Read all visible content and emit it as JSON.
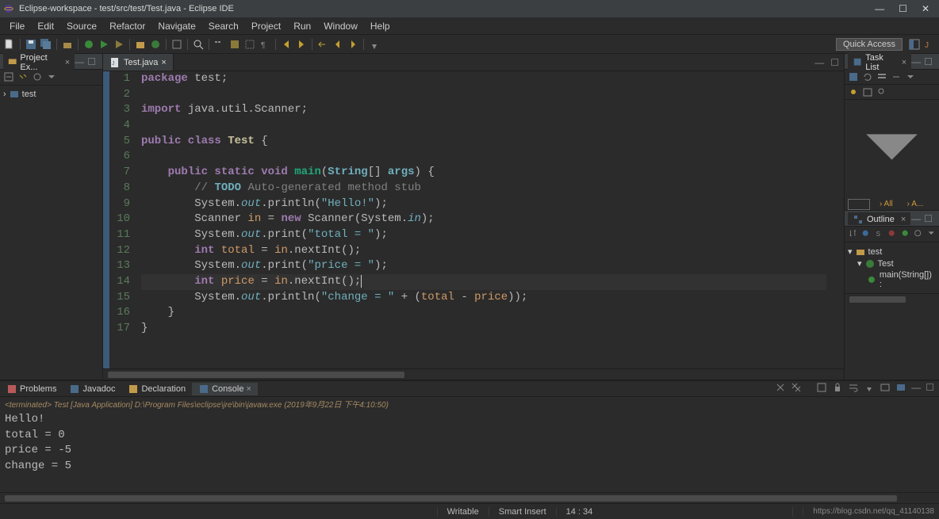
{
  "titlebar": {
    "title": "Eclipse-workspace - test/src/test/Test.java - Eclipse IDE"
  },
  "menu": [
    "File",
    "Edit",
    "Source",
    "Refactor",
    "Navigate",
    "Search",
    "Project",
    "Run",
    "Window",
    "Help"
  ],
  "quick_access": "Quick Access",
  "project_explorer": {
    "title": "Project Ex...",
    "items": [
      {
        "name": "test"
      }
    ]
  },
  "editor": {
    "tab": "Test.java",
    "lines": [
      {
        "n": 1,
        "segs": [
          {
            "t": "package ",
            "c": "kw"
          },
          {
            "t": "test;",
            "c": ""
          }
        ]
      },
      {
        "n": 2,
        "segs": []
      },
      {
        "n": 3,
        "segs": [
          {
            "t": "import ",
            "c": "kw"
          },
          {
            "t": "java.util.Scanner;",
            "c": ""
          }
        ]
      },
      {
        "n": 4,
        "segs": []
      },
      {
        "n": 5,
        "segs": [
          {
            "t": "public class ",
            "c": "kw"
          },
          {
            "t": "Test",
            "c": "cls"
          },
          {
            "t": " {",
            "c": ""
          }
        ]
      },
      {
        "n": 6,
        "segs": []
      },
      {
        "n": 7,
        "segs": [
          {
            "t": "    ",
            "c": ""
          },
          {
            "t": "public static void ",
            "c": "kw"
          },
          {
            "t": "main",
            "c": "method"
          },
          {
            "t": "(",
            "c": ""
          },
          {
            "t": "String",
            "c": "type"
          },
          {
            "t": "[] ",
            "c": ""
          },
          {
            "t": "args",
            "c": "type"
          },
          {
            "t": ") {",
            "c": ""
          }
        ]
      },
      {
        "n": 8,
        "segs": [
          {
            "t": "        ",
            "c": ""
          },
          {
            "t": "// ",
            "c": "comment"
          },
          {
            "t": "TODO",
            "c": "comment-kw"
          },
          {
            "t": " Auto-generated method stub",
            "c": "comment"
          }
        ]
      },
      {
        "n": 9,
        "segs": [
          {
            "t": "        System.",
            "c": ""
          },
          {
            "t": "out",
            "c": "field"
          },
          {
            "t": ".println(",
            "c": ""
          },
          {
            "t": "\"Hello!\"",
            "c": "str"
          },
          {
            "t": ");",
            "c": ""
          }
        ]
      },
      {
        "n": 10,
        "segs": [
          {
            "t": "        Scanner ",
            "c": ""
          },
          {
            "t": "in",
            "c": "name"
          },
          {
            "t": " = ",
            "c": ""
          },
          {
            "t": "new",
            "c": "kw"
          },
          {
            "t": " Scanner(System.",
            "c": ""
          },
          {
            "t": "in",
            "c": "field"
          },
          {
            "t": ");",
            "c": ""
          }
        ]
      },
      {
        "n": 11,
        "segs": [
          {
            "t": "        System.",
            "c": ""
          },
          {
            "t": "out",
            "c": "field"
          },
          {
            "t": ".print(",
            "c": ""
          },
          {
            "t": "\"total = \"",
            "c": "str"
          },
          {
            "t": ");",
            "c": ""
          }
        ]
      },
      {
        "n": 12,
        "segs": [
          {
            "t": "        ",
            "c": ""
          },
          {
            "t": "int",
            "c": "kw"
          },
          {
            "t": " ",
            "c": ""
          },
          {
            "t": "total",
            "c": "name"
          },
          {
            "t": " = ",
            "c": ""
          },
          {
            "t": "in",
            "c": "name"
          },
          {
            "t": ".nextInt();",
            "c": ""
          }
        ]
      },
      {
        "n": 13,
        "segs": [
          {
            "t": "        System.",
            "c": ""
          },
          {
            "t": "out",
            "c": "field"
          },
          {
            "t": ".print(",
            "c": ""
          },
          {
            "t": "\"price = \"",
            "c": "str"
          },
          {
            "t": ");",
            "c": ""
          }
        ]
      },
      {
        "n": 14,
        "segs": [
          {
            "t": "        ",
            "c": ""
          },
          {
            "t": "int",
            "c": "kw"
          },
          {
            "t": " ",
            "c": ""
          },
          {
            "t": "price",
            "c": "name"
          },
          {
            "t": " = ",
            "c": ""
          },
          {
            "t": "in",
            "c": "name"
          },
          {
            "t": ".nextInt();",
            "c": ""
          }
        ],
        "cursor": true,
        "hl": true
      },
      {
        "n": 15,
        "segs": [
          {
            "t": "        System.",
            "c": ""
          },
          {
            "t": "out",
            "c": "field"
          },
          {
            "t": ".println(",
            "c": ""
          },
          {
            "t": "\"change = \"",
            "c": "str"
          },
          {
            "t": " + (",
            "c": ""
          },
          {
            "t": "total",
            "c": "name"
          },
          {
            "t": " - ",
            "c": ""
          },
          {
            "t": "price",
            "c": "name"
          },
          {
            "t": "));",
            "c": ""
          }
        ]
      },
      {
        "n": 16,
        "segs": [
          {
            "t": "    }",
            "c": ""
          }
        ]
      },
      {
        "n": 17,
        "segs": [
          {
            "t": "}",
            "c": ""
          }
        ]
      }
    ]
  },
  "task_list": {
    "title": "Task List"
  },
  "outline": {
    "title": "Outline",
    "items": [
      "test",
      "Test",
      "main(String[]) :"
    ]
  },
  "bottom": {
    "tabs": [
      "Problems",
      "Javadoc",
      "Declaration",
      "Console"
    ],
    "active": "Console",
    "info": "<terminated> Test [Java Application] D:\\Program Files\\eclipse\\jre\\bin\\javaw.exe (2019年9月22日 下午4:10:50)",
    "output": "Hello!\ntotal = 0\nprice = -5\nchange = 5"
  },
  "status": {
    "writable": "Writable",
    "insert": "Smart Insert",
    "pos": "14 : 34",
    "url": "https://blog.csdn.net/qq_41140138"
  },
  "right_label_all": "› All",
  "right_label_a": "› A..."
}
